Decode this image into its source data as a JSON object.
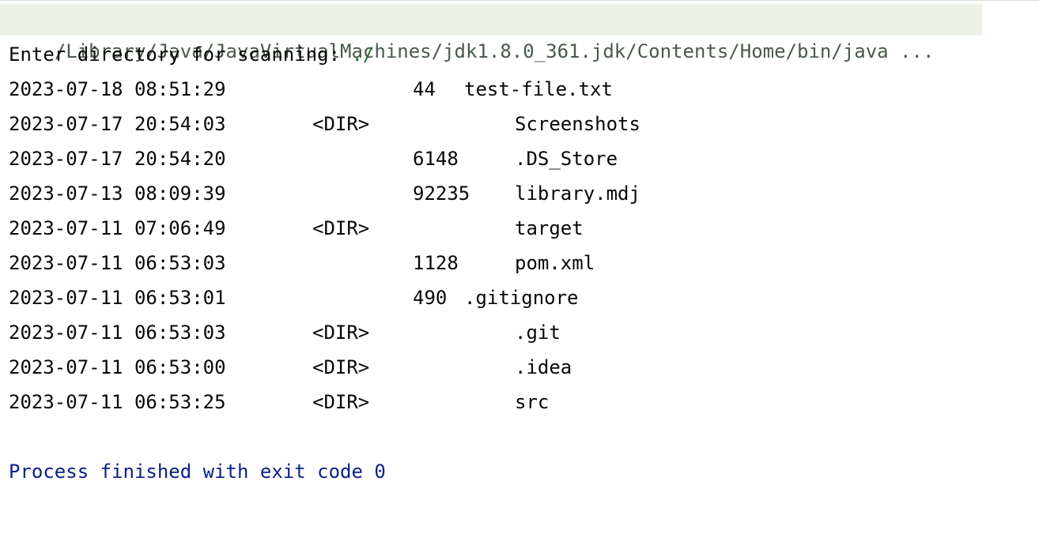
{
  "console": {
    "command": "/Library/Java/JavaVirtualMachines/jdk1.8.0_361.jdk/Contents/Home/bin/java ...",
    "prompt_label": "Enter directory for scanning: ",
    "prompt_input": "./",
    "rows": [
      {
        "datetime": "2023-07-18 08:51:29",
        "type": "",
        "size": "44",
        "name": "test-file.txt"
      },
      {
        "datetime": "2023-07-17 20:54:03",
        "type": "<DIR>",
        "size": "",
        "name": "Screenshots"
      },
      {
        "datetime": "2023-07-17 20:54:20",
        "type": "",
        "size": "6148",
        "name": ".DS_Store"
      },
      {
        "datetime": "2023-07-13 08:09:39",
        "type": "",
        "size": "92235",
        "name": "library.mdj"
      },
      {
        "datetime": "2023-07-11 07:06:49",
        "type": "<DIR>",
        "size": "",
        "name": "target"
      },
      {
        "datetime": "2023-07-11 06:53:03",
        "type": "",
        "size": "1128",
        "name": "pom.xml"
      },
      {
        "datetime": "2023-07-11 06:53:01",
        "type": "",
        "size": "490",
        "name": ".gitignore"
      },
      {
        "datetime": "2023-07-11 06:53:03",
        "type": "<DIR>",
        "size": "",
        "name": ".git"
      },
      {
        "datetime": "2023-07-11 06:53:00",
        "type": "<DIR>",
        "size": "",
        "name": ".idea"
      },
      {
        "datetime": "2023-07-11 06:53:25",
        "type": "<DIR>",
        "size": "",
        "name": "src"
      }
    ],
    "process_message": "Process finished with exit code 0"
  },
  "colors": {
    "command_background": "#edf2e6",
    "input_text": "#1c7a2e",
    "process_text": "#0b1f86",
    "default_text": "#080808"
  }
}
